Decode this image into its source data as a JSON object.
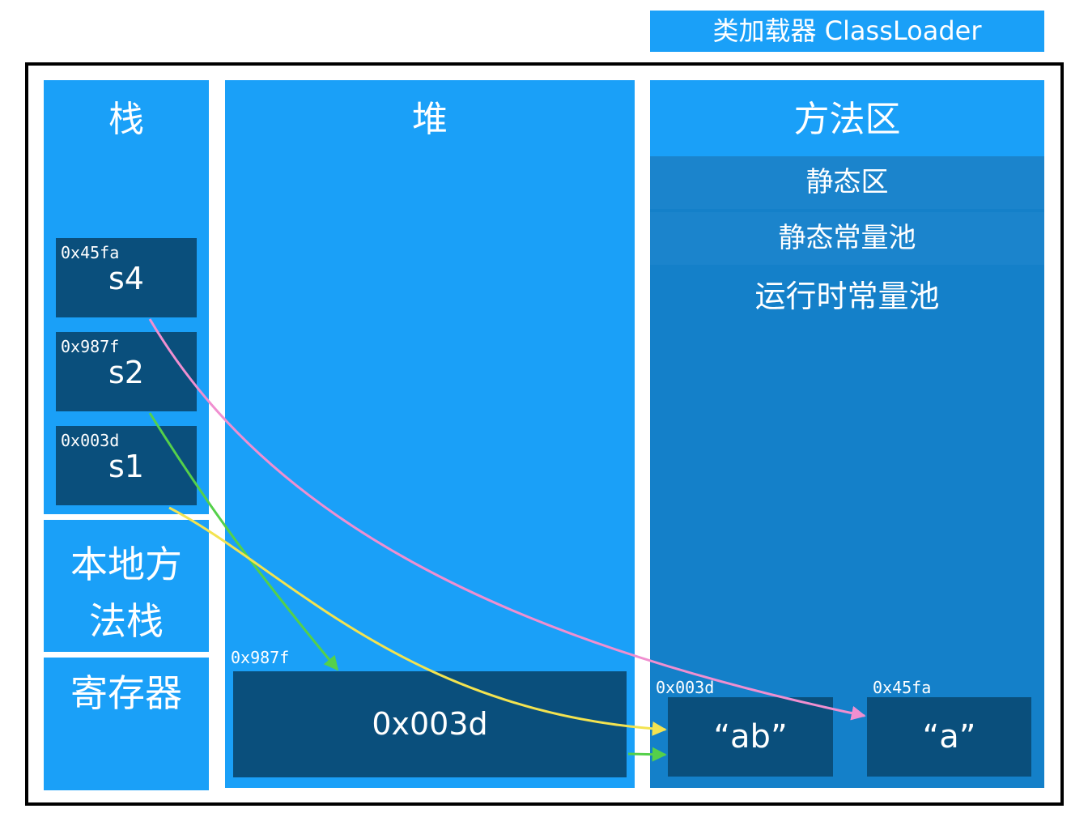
{
  "classloader": {
    "label": "类加载器 ClassLoader"
  },
  "stack": {
    "title": "栈",
    "frames": [
      {
        "addr": "0x45fa",
        "name": "s4"
      },
      {
        "addr": "0x987f",
        "name": "s2"
      },
      {
        "addr": "0x003d",
        "name": "s1"
      }
    ]
  },
  "native_stack": {
    "label_line1": "本地方",
    "label_line2": "法栈"
  },
  "register": {
    "label": "寄存器"
  },
  "heap": {
    "title": "堆",
    "object": {
      "addr": "0x987f",
      "value": "0x003d"
    }
  },
  "method_area": {
    "title": "方法区",
    "static_area": "静态区",
    "static_pool": "静态常量池",
    "runtime_pool": "运行时常量池",
    "strings": [
      {
        "addr": "0x003d",
        "value": "“ab”"
      },
      {
        "addr": "0x45fa",
        "value": "“a”"
      }
    ]
  },
  "arrows": [
    {
      "from": "s4",
      "to": "“a”",
      "color": "#f08fd0"
    },
    {
      "from": "s2",
      "to": "0x987f",
      "color": "#55d04a"
    },
    {
      "from": "s1",
      "to": "“ab”",
      "color": "#f3e350"
    },
    {
      "from": "0x003d",
      "to": "“ab”",
      "color": "#55d04a"
    }
  ]
}
